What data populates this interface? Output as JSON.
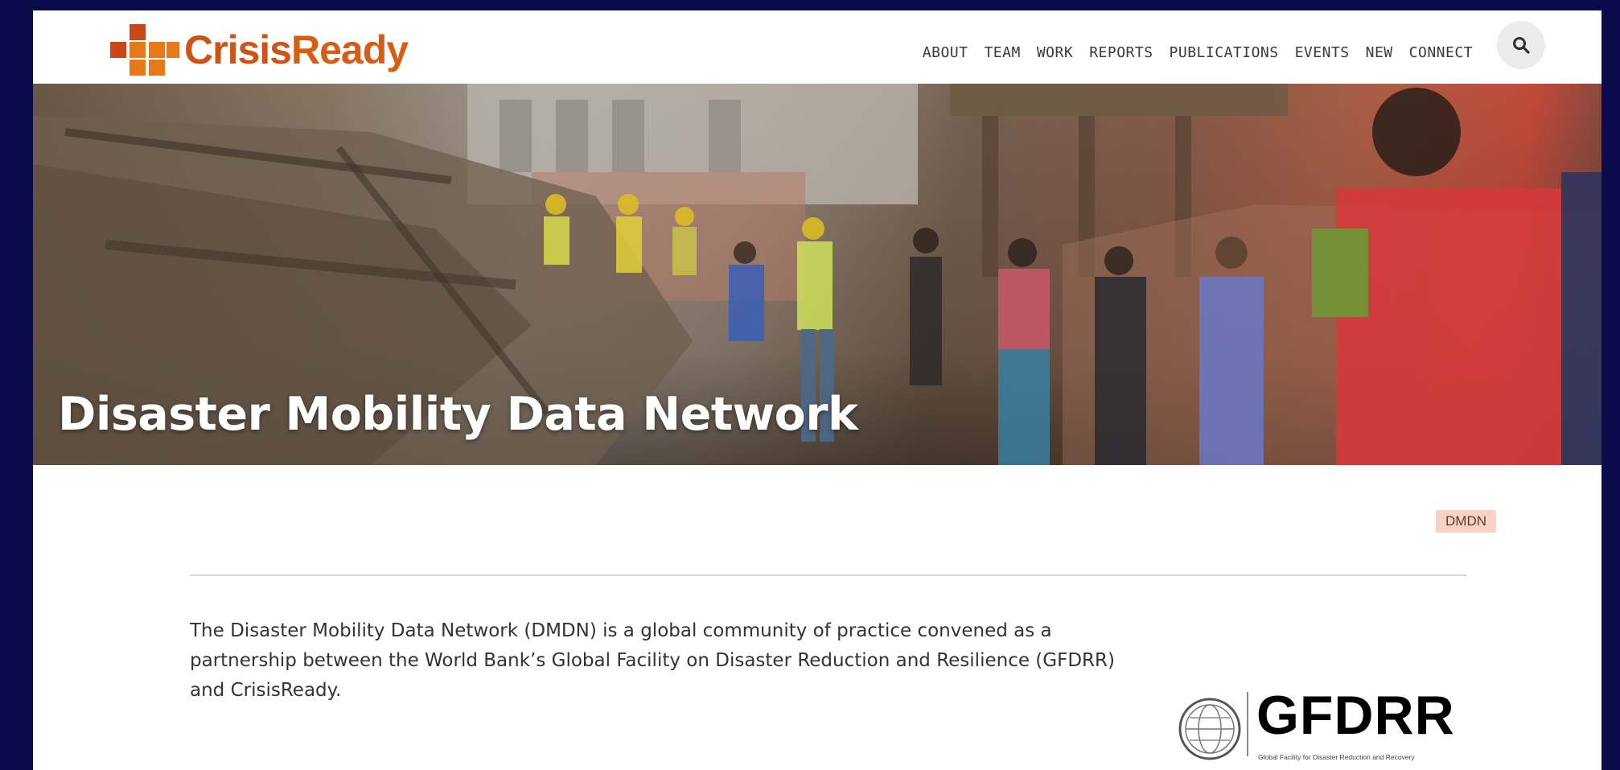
{
  "brand": {
    "name_part1": "Crisis",
    "name_part2": "Ready",
    "colors": {
      "dark_orange": "#c9461b",
      "orange": "#e8791a",
      "red": "#b73a1a"
    }
  },
  "nav": {
    "items": [
      "ABOUT",
      "TEAM",
      "WORK",
      "REPORTS",
      "PUBLICATIONS",
      "EVENTS",
      "NEW",
      "CONNECT"
    ],
    "search_icon": "search-icon"
  },
  "hero": {
    "title": "Disaster Mobility Data Network"
  },
  "tag": {
    "label": "DMDN"
  },
  "intro": {
    "text": "The Disaster Mobility Data Network (DMDN) is a global community of practice convened as a partnership between the World Bank’s Global Facility on Disaster Reduction and Resilience (GFDRR) and CrisisReady."
  },
  "partner_logo": {
    "name": "GFDRR",
    "tagline": "Global Facility for Disaster Reduction and Recovery"
  }
}
